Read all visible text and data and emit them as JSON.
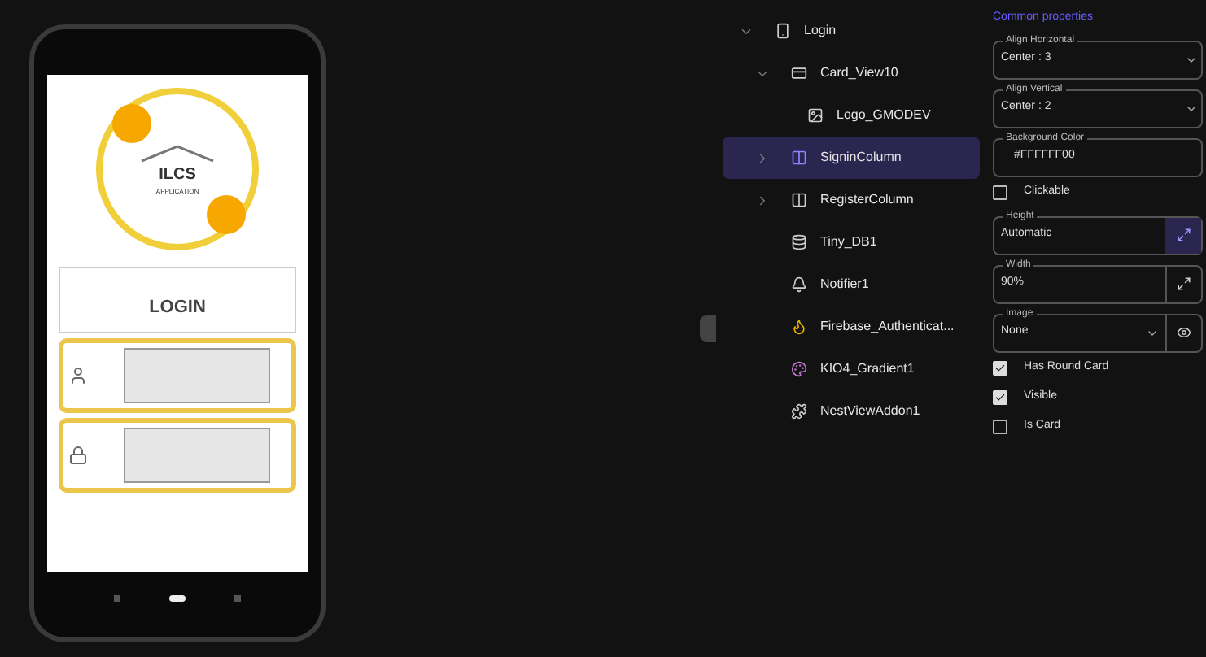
{
  "phone": {
    "logo": {
      "title": "ILCS",
      "subtitle": "APPLICATION"
    },
    "heading": "LOGIN",
    "fields": [
      {
        "kind": "user"
      },
      {
        "kind": "lock"
      }
    ]
  },
  "tree": [
    {
      "label": "Login",
      "kind": "screen",
      "expanded": true,
      "selected": false,
      "children": [
        {
          "label": "Card_View10",
          "kind": "card",
          "expanded": true,
          "selected": false,
          "children": [
            {
              "label": "Logo_GMODEV",
              "kind": "image",
              "selected": false
            }
          ]
        },
        {
          "label": "SigninColumn",
          "kind": "column",
          "expanded": false,
          "selected": true
        },
        {
          "label": "RegisterColumn",
          "kind": "column",
          "expanded": false,
          "selected": false
        },
        {
          "label": "Tiny_DB1",
          "kind": "db",
          "selected": false
        },
        {
          "label": "Notifier1",
          "kind": "bell",
          "selected": false
        },
        {
          "label": "Firebase_Authenticat...",
          "kind": "firebase",
          "selected": false
        },
        {
          "label": "KIO4_Gradient1",
          "kind": "gradient",
          "selected": false
        },
        {
          "label": "NestViewAddon1",
          "kind": "addon",
          "selected": false
        }
      ]
    }
  ],
  "properties": {
    "header": "Common properties",
    "items": [
      {
        "kind": "select",
        "label": "Align Horizontal",
        "value": "Center : 3"
      },
      {
        "kind": "select",
        "label": "Align Vertical",
        "value": "Center : 2"
      },
      {
        "kind": "text",
        "label": "Background Color",
        "value": "#FFFFFF00"
      },
      {
        "kind": "check",
        "label": "Clickable",
        "checked": false
      },
      {
        "kind": "size",
        "label": "Height",
        "value": "Automatic",
        "active": true
      },
      {
        "kind": "size",
        "label": "Width",
        "value": "90%",
        "active": false
      },
      {
        "kind": "image",
        "label": "Image",
        "value": "None"
      },
      {
        "kind": "check",
        "label": "Has Round Card",
        "checked": true
      },
      {
        "kind": "check",
        "label": "Visible",
        "checked": true
      },
      {
        "kind": "check",
        "label": "Is Card",
        "checked": false
      }
    ]
  }
}
